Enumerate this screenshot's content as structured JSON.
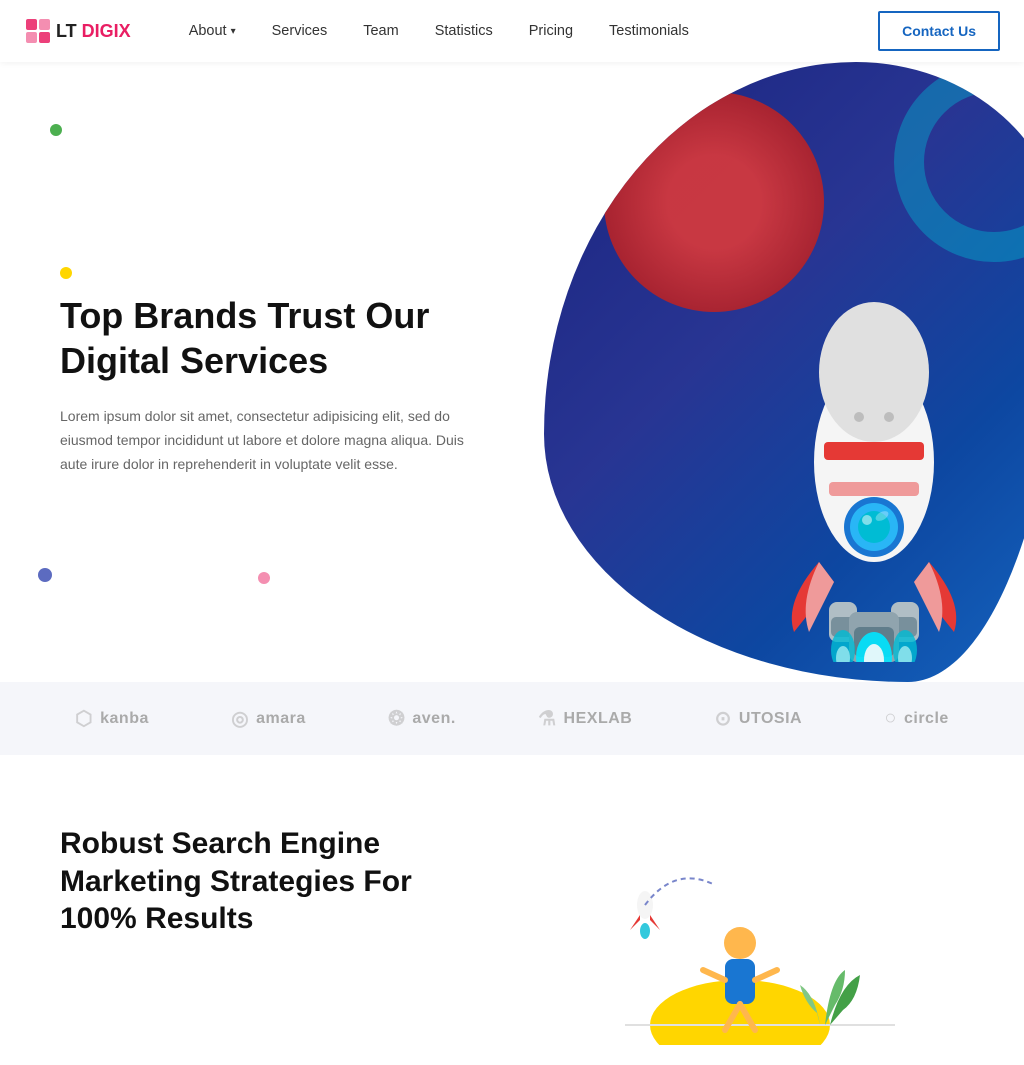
{
  "logo": {
    "lt": "LT",
    "digix": "DIGIX"
  },
  "nav": {
    "links": [
      {
        "label": "About",
        "has_dropdown": true
      },
      {
        "label": "Services",
        "has_dropdown": false
      },
      {
        "label": "Team",
        "has_dropdown": false
      },
      {
        "label": "Statistics",
        "has_dropdown": false
      },
      {
        "label": "Pricing",
        "has_dropdown": false
      },
      {
        "label": "Testimonials",
        "has_dropdown": false
      }
    ],
    "contact_btn": "Contact Us"
  },
  "hero": {
    "title": "Top Brands Trust Our Digital Services",
    "description": "Lorem ipsum dolor sit amet, consectetur adipisicing elit, sed do eiusmod tempor incididunt ut labore et dolore magna aliqua. Duis aute irure dolor in reprehenderit in voluptate velit esse."
  },
  "brands": [
    {
      "icon": "⬡",
      "name": "kanba"
    },
    {
      "icon": "◎",
      "name": "amara"
    },
    {
      "icon": "❂",
      "name": "aven."
    },
    {
      "icon": "⚗",
      "name": "HEXLAB"
    },
    {
      "icon": "⊙",
      "name": "UTOSIA"
    },
    {
      "icon": "○",
      "name": "circle"
    }
  ],
  "section2": {
    "title": "Robust Search Engine Marketing Strategies For 100% Results"
  }
}
